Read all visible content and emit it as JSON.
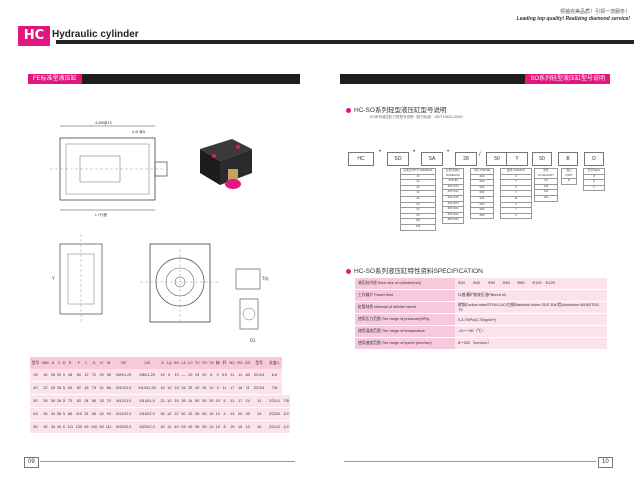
{
  "header": {
    "logo": "HC",
    "title": "Hydraulic cylinder",
    "slogan_cn": "领袖完美品质！引领一流服务！",
    "slogan_en": "Leading top quality! Realizing diamond service!"
  },
  "left": {
    "section_label": "FE标准型液压缸",
    "drawing_labels": {
      "top_dims": "4-M6深15",
      "top_dims2": "A-B 深D",
      "bottom_dim": "L+行程",
      "view_label": "T向",
      "side_labels": [
        "Y",
        "D1"
      ]
    },
    "table": {
      "headers": [
        "型号",
        "MM",
        "A",
        "C",
        "D",
        "E",
        "F",
        "L",
        "G",
        "H",
        "M",
        "NF",
        "LM",
        "S",
        "LQ",
        "KK",
        "LA",
        "LC",
        "TV",
        "TH",
        "TZ",
        "轴",
        "杆",
        "NC",
        "RC",
        "ZG",
        "型号",
        "长度/L"
      ],
      "rows": [
        [
          "06",
          "16",
          "28",
          "20",
          "0",
          "48",
          "60",
          "12",
          "72",
          "29",
          "98",
          "M8X1.25",
          "M8X1.25",
          "15",
          "6",
          "13",
          "—",
          "20",
          "24",
          "20",
          "6",
          "9",
          "6.5",
          "11",
          "11",
          "A5",
          "ZG1/4",
          "6.6"
        ],
        [
          "40",
          "22",
          "28",
          "28",
          "5",
          "63",
          "82",
          "18",
          "73",
          "31",
          "66",
          "M10X1.5",
          "M10X1.25",
          "18",
          "10",
          "19",
          "34",
          "25",
          "40",
          "28",
          "10",
          "9",
          "11",
          "17",
          "18",
          "11",
          "ZG1/4",
          "7/8"
        ],
        [
          "50",
          "28",
          "34",
          "28",
          "5",
          "73",
          "92",
          "24",
          "86",
          "33",
          "70",
          "M12X1.5",
          "M14X1.5",
          "22",
          "10",
          "19",
          "35",
          "24",
          "50",
          "45",
          "30",
          "10",
          "5",
          "11",
          "17",
          "24",
          "11",
          "ZG1/4",
          "7/8"
        ],
        [
          "63",
          "35",
          "34",
          "38",
          "5",
          "86",
          "110",
          "31",
          "96",
          "44",
          "93",
          "M14X2.0",
          "M16X2.0",
          "30",
          "12",
          "22",
          "50",
          "32",
          "55",
          "55",
          "15",
          "12",
          "5",
          "13",
          "20",
          "30",
          "13",
          "ZG3/8",
          "1/2"
        ],
        [
          "80",
          "45",
          "34",
          "40",
          "6",
          "111",
          "135",
          "49",
          "100",
          "59",
          "111",
          "M16X2.0",
          "M20X2.0",
          "40",
          "12",
          "40",
          "63",
          "45",
          "65",
          "55",
          "13",
          "15",
          "8",
          "19",
          "15",
          "10",
          "16",
          "ZG1/4",
          "1/2"
        ]
      ]
    }
  },
  "right": {
    "section_label": "SO系列轻型液压缸型号说明",
    "heading1": "HC-SO系列轻型液压缸型号说明",
    "sub1": "SO系列液压缸订货型号说明（执行标准：GB/T15622-2005）",
    "model_boxes": [
      "HC",
      "SO",
      "SA",
      "28",
      "50",
      "Y",
      "50",
      "B",
      "D"
    ],
    "box_captions": [
      "标准缸径代号 ADDRESS",
      "缸径/活塞杆 BORE/ROD",
      "行程 STROKE",
      "缓冲 CUSHION",
      "附件 ACCESSORY",
      "油口 PORT",
      "密封 SEAL"
    ],
    "heading2": "HC-SO系列液压缸特性资料SPECIFICATION",
    "spec": [
      {
        "k": "液压缸内径 Bore size of cylinder(mm)",
        "v": "Φ32　　Φ40　　Φ50　　Φ63　　Φ80　　Φ100　Φ125"
      },
      {
        "k": "工作媒介 Power fluid",
        "v": "以普通矿物液压油Filtered oil"
      },
      {
        "k": "缸管材质 Material of dilinder barrel",
        "v": "碳钢Carbon steelSTKM-13C/白钢Stainless tubes SUS 304/铝Aluminium A6063TDS-T5"
      },
      {
        "k": "使用压力范围 The range of pressure(MPa)",
        "v": "0.3-7MPa(3-70kg/cm²)"
      },
      {
        "k": "使用温度范围 The range of temperature",
        "v": "-10～+80（℃）"
      },
      {
        "k": "使用速度范围 The range of speed (mm/sec)",
        "v": "8～300（mm/sec）"
      }
    ]
  },
  "pages": {
    "left": "09",
    "right": "10"
  },
  "colors": {
    "accent": "#e2177e",
    "bar": "#1e1e1e",
    "table_head": "#f6c9dd",
    "table_row": "#fbe3ee"
  }
}
